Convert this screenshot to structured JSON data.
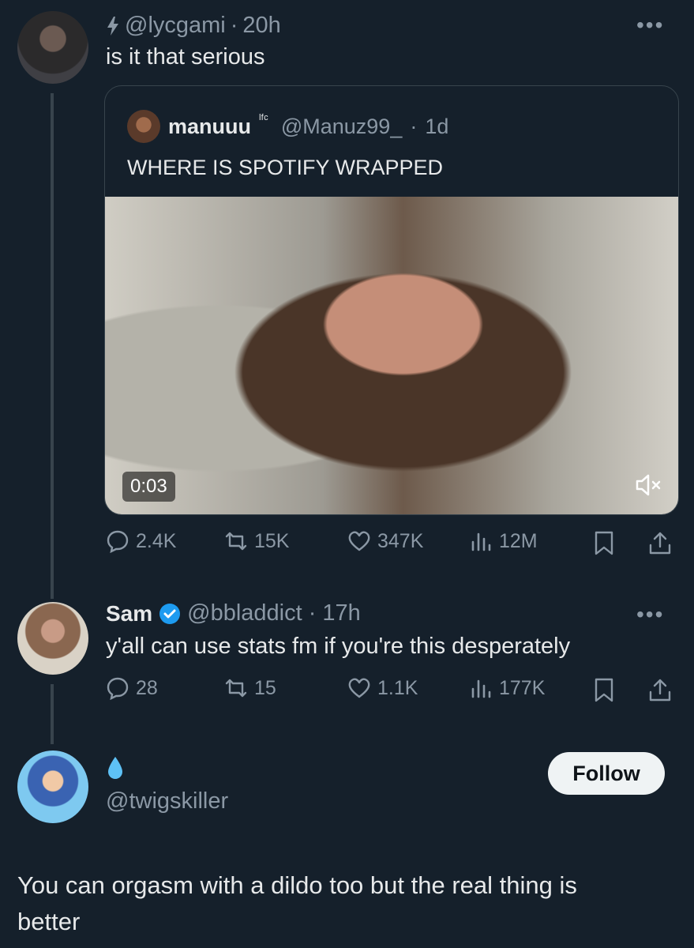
{
  "tweet1": {
    "prefix_icon": "lightning-icon",
    "handle": "@lycgami",
    "time": "20h",
    "text": "is it that serious",
    "more": "•••"
  },
  "quote": {
    "name": "manuuu",
    "name_suffix": "ˡᶠᶜ",
    "handle": "@Manuz99_",
    "time": "1d",
    "text": "WHERE IS SPOTIFY WRAPPED",
    "video_time": "0:03",
    "mute_icon": "volume-mute-icon"
  },
  "tweet1_stats": {
    "replies": "2.4K",
    "retweets": "15K",
    "likes": "347K",
    "views": "12M"
  },
  "tweet2": {
    "name": "Sam",
    "handle": "@bbladdict",
    "time": "17h",
    "text": "y'all can use stats fm if you're this desperately",
    "more": "•••",
    "stats": {
      "replies": "28",
      "retweets": "15",
      "likes": "1.1K",
      "views": "177K"
    }
  },
  "tweet3": {
    "emoji": "💧",
    "handle": "@twigskiller",
    "follow_label": "Follow",
    "text_line1": "You can orgasm with a dildo too but the real thing is",
    "text_line2": "better"
  },
  "colors": {
    "background": "#15202b",
    "text": "#e7e9ea",
    "muted": "#8b98a5",
    "verified": "#1d9bf0"
  }
}
